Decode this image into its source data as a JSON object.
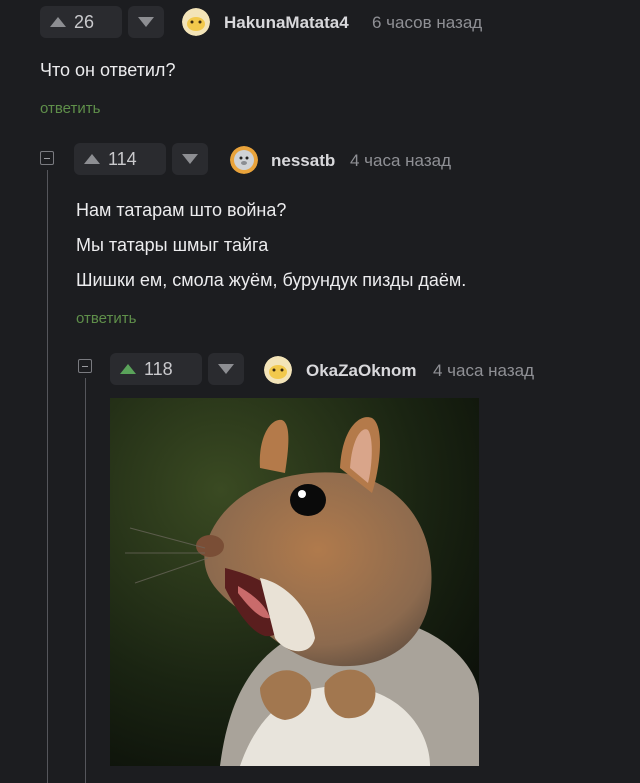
{
  "comments": [
    {
      "votes": "26",
      "username": "HakunaMatata4",
      "time": "6 часов назад",
      "lines": [
        "Что он ответил?"
      ],
      "reply": "ответить"
    },
    {
      "votes": "114",
      "username": "nessatb",
      "time": "4 часа назад",
      "lines": [
        "Нам татарам што война?",
        "Мы татары шмыг тайга",
        "Шишки ем, смола жуём, бурундук пизды даём."
      ],
      "reply": "ответить"
    },
    {
      "votes": "118",
      "username": "OkaZaOknom",
      "time": "4 часа назад",
      "image": "squirrel-open-mouth-photo"
    }
  ],
  "colors": {
    "background": "#1c1d20",
    "reply_link": "#5f8f4a",
    "upvoted": "#5aa35a"
  }
}
